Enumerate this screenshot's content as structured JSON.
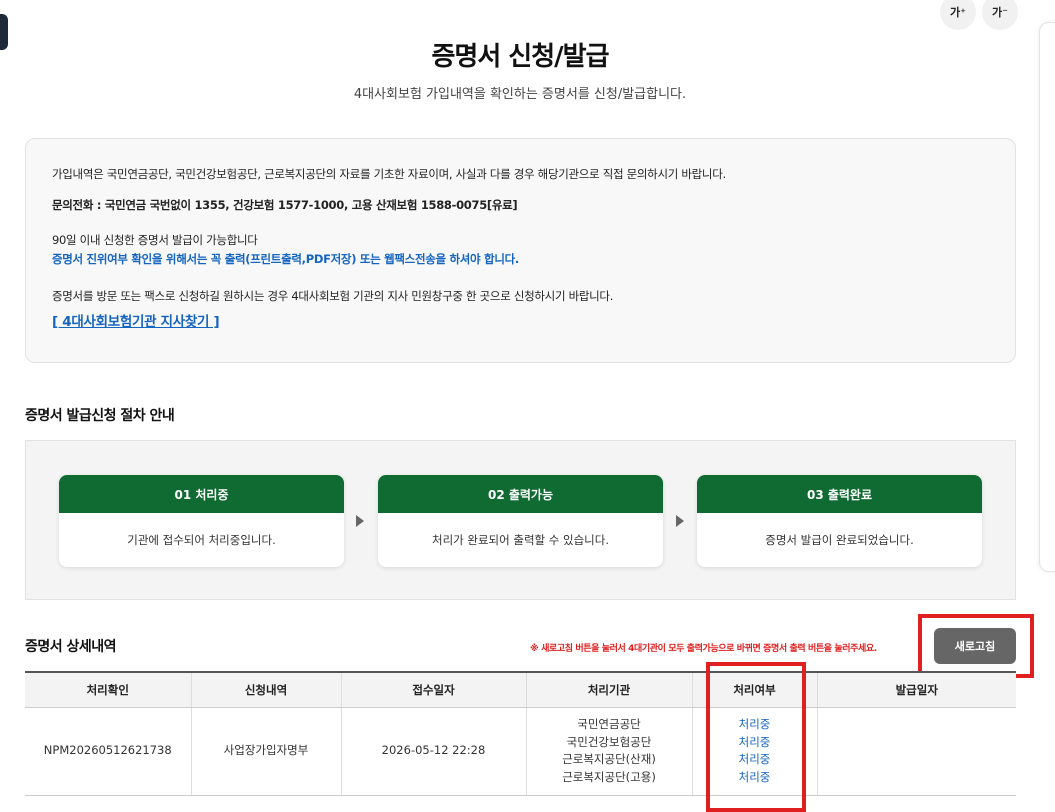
{
  "font_controls": {
    "increase": "가⁺",
    "decrease": "가⁻"
  },
  "page": {
    "title": "증명서 신청/발급",
    "subtitle": "4대사회보험 가입내역을 확인하는 증명서를 신청/발급합니다."
  },
  "info": {
    "line1": "가입내역은 국민연금공단, 국민건강보험공단, 근로복지공단의 자료를 기초한 자료이며, 사실과 다를 경우 해당기관으로 직접 문의하시기 바랍니다.",
    "contact": "문의전화 : 국민연금 국번없이 1355, 건강보험 1577-1000, 고용 산재보험 1588-0075[유료]",
    "line3": "90일 이내 신청한 증명서 발급이 가능합니다",
    "line4": "증명서 진위여부 확인을 위해서는 꼭 출력(프린트출력,PDF저장) 또는 웹팩스전송을 하셔야 합니다.",
    "line5": "증명서를 방문 또는 팩스로 신청하길 원하시는 경우 4대사회보험 기관의 지사 민원창구중 한 곳으로 신청하시기 바랍니다.",
    "branch_link": "[ 4대사회보험기관 지사찾기 ]"
  },
  "procedure": {
    "title": "증명서 발급신청 절차 안내",
    "steps": [
      {
        "label": "01 처리중",
        "desc": "기관에 접수되어 처리중입니다."
      },
      {
        "label": "02 출력가능",
        "desc": "처리가 완료되어 출력할 수 있습니다."
      },
      {
        "label": "03 출력완료",
        "desc": "증명서 발급이 완료되었습니다."
      }
    ]
  },
  "details": {
    "title": "증명서 상세내역",
    "notice": "※ 새로고침 버튼을 눌러서 4대기관이 모두 출력가능으로 바뀌면 증명서 출력 버튼을 눌러주세요.",
    "refresh_label": "새로고침",
    "columns": [
      "처리확인",
      "신청내역",
      "접수일자",
      "처리기관",
      "처리여부",
      "발급일자"
    ],
    "row": {
      "id": "NPM20260512621738",
      "type": "사업장가입자명부",
      "date": "2026-05-12 22:28",
      "agencies": [
        "국민연금공단",
        "국민건강보험공단",
        "근로복지공단(산재)",
        "근로복지공단(고용)"
      ],
      "statuses": [
        "처리중",
        "처리중",
        "처리중",
        "처리중"
      ],
      "issue_date": ""
    }
  },
  "colors": {
    "accent_green": "#0f6b32",
    "link_blue": "#1565c0",
    "highlight_red": "#e02020"
  }
}
